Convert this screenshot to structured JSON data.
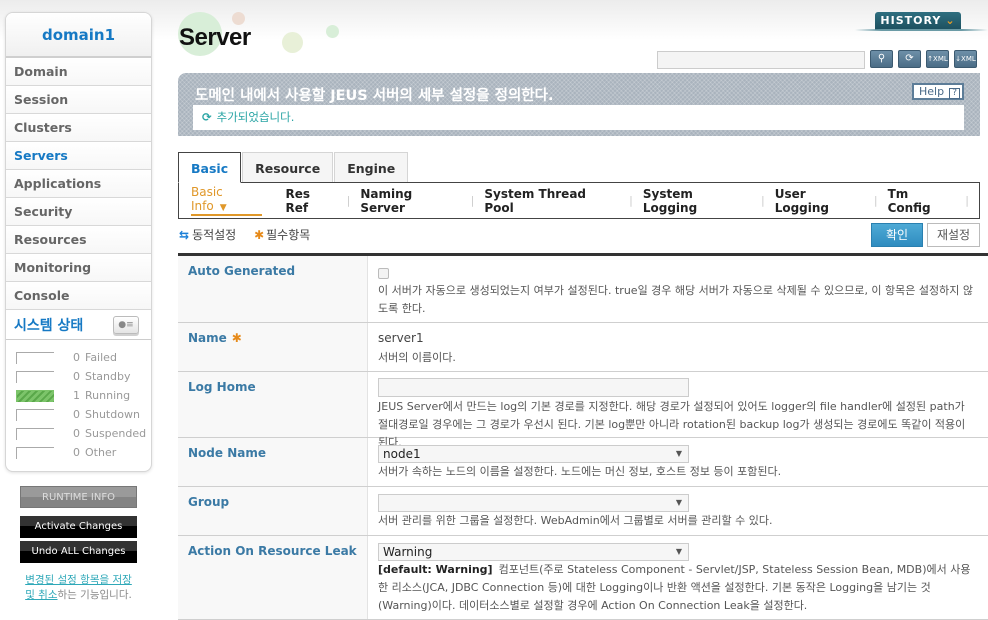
{
  "sidebar": {
    "domain": "domain1",
    "items": [
      {
        "label": "Domain",
        "active": false
      },
      {
        "label": "Session",
        "active": false
      },
      {
        "label": "Clusters",
        "active": false
      },
      {
        "label": "Servers",
        "active": true
      },
      {
        "label": "Applications",
        "active": false
      },
      {
        "label": "Security",
        "active": false
      },
      {
        "label": "Resources",
        "active": false
      },
      {
        "label": "Monitoring",
        "active": false
      },
      {
        "label": "Console",
        "active": false
      }
    ],
    "system_status": {
      "title": "시스템 상태",
      "rows": [
        {
          "count": "0",
          "label": "Failed",
          "active": false
        },
        {
          "count": "0",
          "label": "Standby",
          "active": false
        },
        {
          "count": "1",
          "label": "Running",
          "active": true
        },
        {
          "count": "0",
          "label": "Shutdown",
          "active": false
        },
        {
          "count": "0",
          "label": "Suspended",
          "active": false
        },
        {
          "count": "0",
          "label": "Other",
          "active": false
        }
      ]
    },
    "buttons": {
      "runtime_info": "RUNTIME INFO",
      "activate": "Activate Changes",
      "undo": "Undo ALL Changes"
    },
    "note_link": "변경된 설정 항목을 저장 및 취소",
    "note_rest": "하는 기능입니다."
  },
  "header": {
    "title": "Server",
    "history_label": "HISTORY",
    "search_placeholder": "",
    "tools": [
      "search-icon",
      "refresh-icon",
      "xml-export-icon",
      "xml-import-icon"
    ]
  },
  "description": {
    "text": "도메인 내에서 사용할 JEUS 서버의 세부 설정을 정의한다.",
    "help_label": "Help",
    "message": "추가되었습니다."
  },
  "tabs": [
    {
      "label": "Basic",
      "active": true
    },
    {
      "label": "Resource",
      "active": false
    },
    {
      "label": "Engine",
      "active": false
    }
  ],
  "subtabs": [
    {
      "label": "Basic Info",
      "active": true
    },
    {
      "label": "Res Ref",
      "active": false
    },
    {
      "label": "Naming Server",
      "active": false
    },
    {
      "label": "System Thread Pool",
      "active": false
    },
    {
      "label": "System Logging",
      "active": false
    },
    {
      "label": "User Logging",
      "active": false
    },
    {
      "label": "Tm Config",
      "active": false
    }
  ],
  "legend": {
    "dynamic": "동적설정",
    "required": "필수항목"
  },
  "actions": {
    "ok": "확인",
    "reset": "재설정"
  },
  "form": {
    "auto_generated": {
      "label": "Auto Generated",
      "checked": false,
      "desc": "이 서버가 자동으로 생성되었는지 여부가 설정된다. true일 경우 해당 서버가 자동으로 삭제될 수 있으므로, 이 항목은 설정하지 않도록 한다."
    },
    "name": {
      "label": "Name",
      "value": "server1",
      "desc": "서버의 이름이다."
    },
    "log_home": {
      "label": "Log Home",
      "value": "",
      "desc": "JEUS Server에서 만드는 log의 기본 경로를 지정한다. 해당 경로가 설정되어 있어도 logger의 file handler에 설정된 path가 절대경로일 경우에는 그 경로가 우선시 된다. 기본 log뿐만 아니라 rotation된 backup log가 생성되는 경로에도 똑같이 적용이 된다."
    },
    "node_name": {
      "label": "Node Name",
      "value": "node1",
      "desc": "서버가 속하는 노드의 이름을 설정한다. 노드에는 머신 정보, 호스트 정보 등이 포함된다."
    },
    "group": {
      "label": "Group",
      "value": "",
      "desc": "서버 관리를 위한 그룹을 설정한다. WebAdmin에서 그룹별로 서버를 관리할 수 있다."
    },
    "action_on_resource_leak": {
      "label": "Action On Resource Leak",
      "value": "Warning",
      "default": "[default: Warning]",
      "desc": "컴포넌트(주로 Stateless Component - Servlet/JSP, Stateless Session Bean, MDB)에서 사용한 리소스(JCA, JDBC Connection 등)에 대한 Logging이나 반환 액션을 설정한다. 기본 동작은 Logging을 남기는 것(Warning)이다. 데이터소스별로 설정할 경우에 Action On Connection Leak을 설정한다."
    }
  }
}
